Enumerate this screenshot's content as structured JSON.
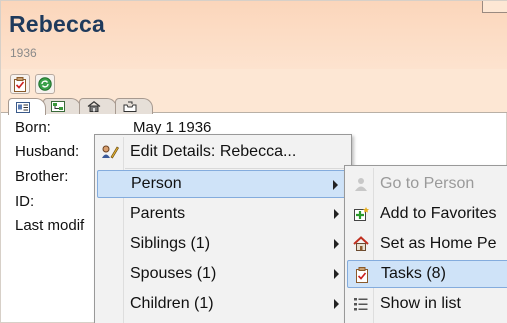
{
  "person": {
    "name": "Rebecca",
    "year": "1936"
  },
  "fields": [
    {
      "label": "Born:"
    },
    {
      "label": "Husband:"
    },
    {
      "label": "Brother:"
    },
    {
      "label": "ID:"
    },
    {
      "label": "Last modif"
    }
  ],
  "born_value": "May 1 1936",
  "toolbar": {
    "buttons": [
      {
        "icon": "tasks-icon"
      },
      {
        "icon": "sync-icon"
      }
    ]
  },
  "tabs": [
    {
      "icon": "details-card-icon",
      "active": true
    },
    {
      "icon": "family-tree-icon",
      "active": false
    },
    {
      "icon": "house-icon",
      "active": false
    },
    {
      "icon": "inbox-icon",
      "active": false
    }
  ],
  "context_menu": {
    "items": [
      {
        "label": "Edit Details: Rebecca...",
        "icon": "edit-details-icon",
        "submenu": false,
        "highlighted": false
      },
      {
        "label": "Person",
        "submenu": true,
        "highlighted": true
      },
      {
        "label": "Parents",
        "submenu": true,
        "highlighted": false
      },
      {
        "label": "Siblings (1)",
        "submenu": true,
        "highlighted": false
      },
      {
        "label": "Spouses (1)",
        "submenu": true,
        "highlighted": false
      },
      {
        "label": "Children (1)",
        "submenu": true,
        "highlighted": false
      }
    ]
  },
  "person_submenu": {
    "items": [
      {
        "label": "Go to Person",
        "icon": "go-to-person-icon",
        "disabled": true,
        "highlighted": false
      },
      {
        "label": "Add to Favorites",
        "icon": "add-favorite-icon",
        "disabled": false,
        "highlighted": false
      },
      {
        "label": "Set as Home Pe",
        "icon": "home-icon",
        "disabled": false,
        "highlighted": false
      },
      {
        "label": "Tasks (8)",
        "icon": "tasks-icon",
        "disabled": false,
        "highlighted": true
      },
      {
        "label": "Show in list",
        "icon": "list-icon",
        "disabled": false,
        "highlighted": false
      }
    ]
  },
  "colors": {
    "header_bg": "#fbd6bb",
    "name_text": "#1f3a5c",
    "menu_bg": "#f2f2f2",
    "highlight_bg": "#cfe3f8",
    "highlight_border": "#84acdd"
  }
}
